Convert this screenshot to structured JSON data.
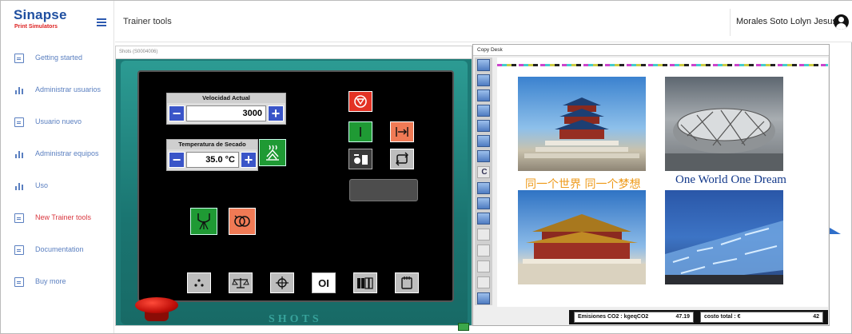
{
  "brand": {
    "name": "Sinapse",
    "tagline": "Print Simulators"
  },
  "sidebar": {
    "items": [
      {
        "label": "Getting started",
        "icon": "document-icon"
      },
      {
        "label": "Administrar usuarios",
        "icon": "bar-chart-icon"
      },
      {
        "label": "Usuario nuevo",
        "icon": "id-card-icon"
      },
      {
        "label": "Administrar equipos",
        "icon": "bar-chart-icon"
      },
      {
        "label": "Uso",
        "icon": "bar-chart-icon"
      },
      {
        "label": "New Trainer tools",
        "icon": "document-icon",
        "highlight": "#d9363e"
      },
      {
        "label": "Documentation",
        "icon": "document-icon"
      },
      {
        "label": "Buy more",
        "icon": "document-icon"
      }
    ]
  },
  "header": {
    "title": "Trainer tools",
    "user": "Morales Soto Lolyn Jesus"
  },
  "shots": {
    "panel_title": "Shots (S0004006)",
    "speed": {
      "label": "Velocidad Actual",
      "value": "3000",
      "minus": "−",
      "plus": "+"
    },
    "temperature": {
      "label": "Temperatura de Secado",
      "value": "35.0 °C",
      "minus": "−",
      "plus": "+"
    },
    "brand": "SHOTS",
    "button_icons": [
      "stop-icon",
      "power-on-icon",
      "arrow-expand-icon",
      "feeder-icon",
      "cycle-icon",
      "heat-icon",
      "blanket-icon",
      "roller-icon",
      "dots-icon",
      "balance-icon",
      "crosshair-icon",
      "on-off-icon",
      "ink-units-icon",
      "tray-icon",
      "emergency-stop-icon"
    ],
    "on_off_label": "OI"
  },
  "copy_desk": {
    "panel_title": "Copy Desk",
    "caption_cn": "同一个世界   同一个梦想",
    "caption_en": "One World One Dream",
    "emissions_label": "Emisiones CO2 :  kgeqCO2",
    "emissions_value": "47.19",
    "cost_label": "costo total :    €",
    "cost_value": "42",
    "tool_glyph": "C"
  },
  "colors": {
    "accent": "#1f4fa0",
    "nav": "#5a7fc0",
    "nav_active": "#d9363e",
    "machine_body": "#1d7a76"
  }
}
